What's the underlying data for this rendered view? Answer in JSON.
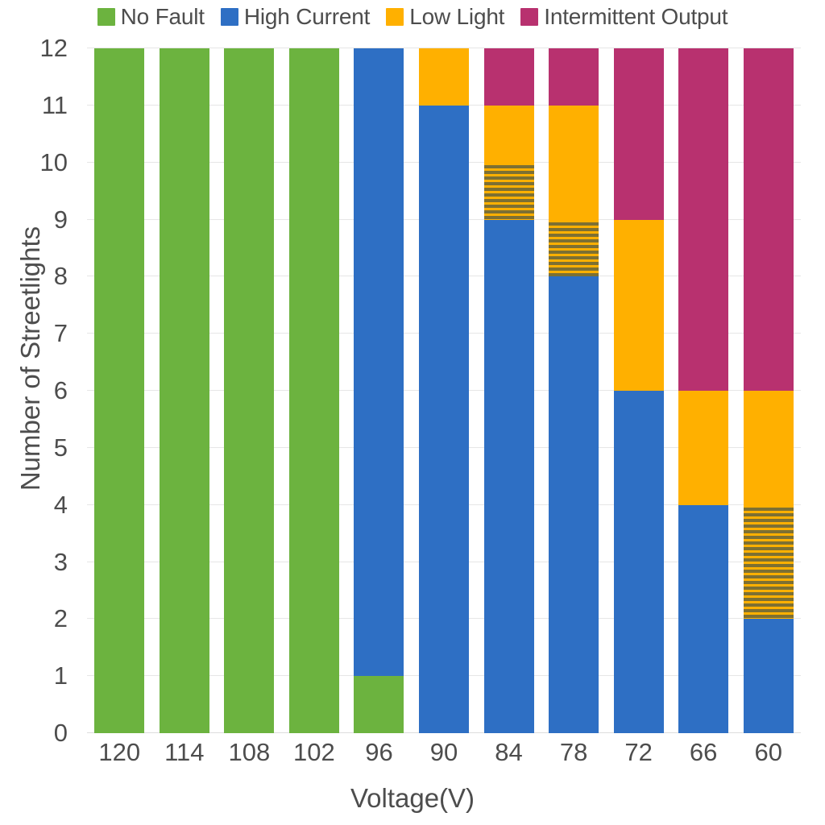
{
  "legend": {
    "items": [
      {
        "label": "No Fault",
        "key": "no_fault",
        "color": "#6CB33F"
      },
      {
        "label": "High Current",
        "key": "high_current",
        "color": "#2E6FC4"
      },
      {
        "label": "Low Light",
        "key": "low_light",
        "color": "#FFB000"
      },
      {
        "label": "Intermittent Output",
        "key": "intermittent_output",
        "color": "#B8316F"
      }
    ]
  },
  "axes": {
    "x_title": "Voltage(V)",
    "y_title": "Number of Streetlights",
    "y_ticks": [
      "0",
      "1",
      "2",
      "3",
      "4",
      "5",
      "6",
      "7",
      "8",
      "9",
      "10",
      "11",
      "12"
    ],
    "x_ticks": [
      "120",
      "114",
      "108",
      "102",
      "96",
      "90",
      "84",
      "78",
      "72",
      "66",
      "60"
    ]
  },
  "chart_data": {
    "type": "bar",
    "subtype": "stacked",
    "title": "",
    "xlabel": "Voltage(V)",
    "ylabel": "Number of Streetlights",
    "ylim": [
      0,
      12
    ],
    "grid": true,
    "legend_position": "top",
    "categories": [
      "120",
      "114",
      "108",
      "102",
      "96",
      "90",
      "84",
      "78",
      "72",
      "66",
      "60"
    ],
    "series": [
      {
        "name": "No Fault",
        "color": "#6CB33F",
        "values": [
          12,
          12,
          12,
          12,
          1,
          0,
          0,
          0,
          0,
          0,
          0
        ]
      },
      {
        "name": "High Current",
        "color": "#2E6FC4",
        "values": [
          0,
          0,
          0,
          0,
          11,
          11,
          10,
          9,
          6,
          4,
          4
        ]
      },
      {
        "name": "Low Light",
        "color": "#FFB000",
        "values": [
          0,
          0,
          0,
          0,
          0,
          1,
          2,
          3,
          3,
          2,
          4
        ]
      },
      {
        "name": "Intermittent Output",
        "color": "#B8316F",
        "values": [
          0,
          0,
          0,
          0,
          0,
          0,
          2,
          1,
          3,
          6,
          6
        ]
      }
    ],
    "stacks": [
      {
        "category": "120",
        "segments": [
          {
            "series": "No Fault",
            "from": 0,
            "to": 12,
            "hatched": false
          }
        ]
      },
      {
        "category": "114",
        "segments": [
          {
            "series": "No Fault",
            "from": 0,
            "to": 12,
            "hatched": false
          }
        ]
      },
      {
        "category": "108",
        "segments": [
          {
            "series": "No Fault",
            "from": 0,
            "to": 12,
            "hatched": false
          }
        ]
      },
      {
        "category": "102",
        "segments": [
          {
            "series": "No Fault",
            "from": 0,
            "to": 12,
            "hatched": false
          }
        ]
      },
      {
        "category": "96",
        "segments": [
          {
            "series": "No Fault",
            "from": 0,
            "to": 1,
            "hatched": false
          },
          {
            "series": "High Current",
            "from": 1,
            "to": 12,
            "hatched": false
          }
        ]
      },
      {
        "category": "90",
        "segments": [
          {
            "series": "High Current",
            "from": 0,
            "to": 11,
            "hatched": false
          },
          {
            "series": "Low Light",
            "from": 11,
            "to": 12,
            "hatched": false
          }
        ]
      },
      {
        "category": "84",
        "segments": [
          {
            "series": "High Current",
            "from": 0,
            "to": 9,
            "hatched": false
          },
          {
            "series": "Low Light",
            "from": 9,
            "to": 10,
            "hatched": true
          },
          {
            "series": "Low Light",
            "from": 10,
            "to": 11,
            "hatched": false
          },
          {
            "series": "Intermittent Output",
            "from": 11,
            "to": 12,
            "hatched": false
          }
        ]
      },
      {
        "category": "78",
        "segments": [
          {
            "series": "High Current",
            "from": 0,
            "to": 8,
            "hatched": false
          },
          {
            "series": "Low Light",
            "from": 8,
            "to": 9,
            "hatched": true
          },
          {
            "series": "Low Light",
            "from": 9,
            "to": 11,
            "hatched": false
          },
          {
            "series": "Intermittent Output",
            "from": 11,
            "to": 12,
            "hatched": false
          }
        ]
      },
      {
        "category": "72",
        "segments": [
          {
            "series": "High Current",
            "from": 0,
            "to": 6,
            "hatched": false
          },
          {
            "series": "Low Light",
            "from": 6,
            "to": 9,
            "hatched": false
          },
          {
            "series": "Intermittent Output",
            "from": 9,
            "to": 12,
            "hatched": false
          }
        ]
      },
      {
        "category": "66",
        "segments": [
          {
            "series": "High Current",
            "from": 0,
            "to": 4,
            "hatched": false
          },
          {
            "series": "Low Light",
            "from": 4,
            "to": 6,
            "hatched": false
          },
          {
            "series": "Intermittent Output",
            "from": 6,
            "to": 12,
            "hatched": false
          }
        ]
      },
      {
        "category": "60",
        "segments": [
          {
            "series": "High Current",
            "from": 0,
            "to": 2,
            "hatched": false
          },
          {
            "series": "Low Light",
            "from": 2,
            "to": 4,
            "hatched": true
          },
          {
            "series": "Low Light",
            "from": 4,
            "to": 6,
            "hatched": false
          },
          {
            "series": "Intermittent Output",
            "from": 6,
            "to": 12,
            "hatched": false
          }
        ]
      }
    ]
  },
  "style": {
    "hatch_dark": "#7d7033",
    "text_color": "#4d4d4d",
    "grid_color": "#e6e6e6",
    "background": "#ffffff"
  }
}
